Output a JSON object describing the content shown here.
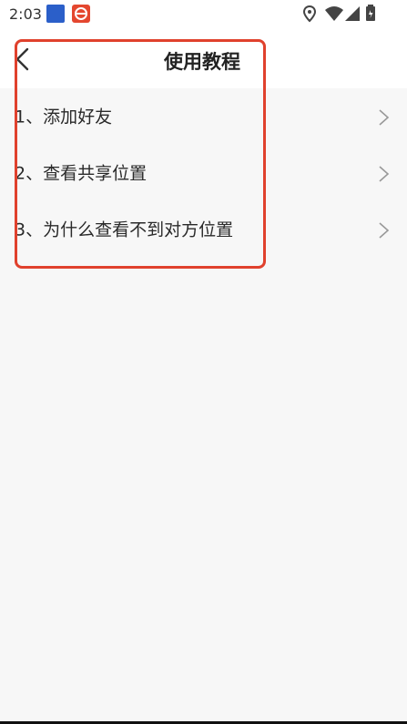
{
  "status_bar": {
    "time": "2:03"
  },
  "header": {
    "title": "使用教程"
  },
  "list": {
    "items": [
      {
        "label": "1、添加好友"
      },
      {
        "label": "2、查看共享位置"
      },
      {
        "label": "3、为什么查看不到对方位置"
      }
    ]
  },
  "colors": {
    "highlight": "#e0412d",
    "background": "#f7f7f7"
  },
  "icons": [
    "back-arrow-icon",
    "chevron-right-icon",
    "location-icon",
    "wifi-icon",
    "signal-icon",
    "battery-icon"
  ]
}
